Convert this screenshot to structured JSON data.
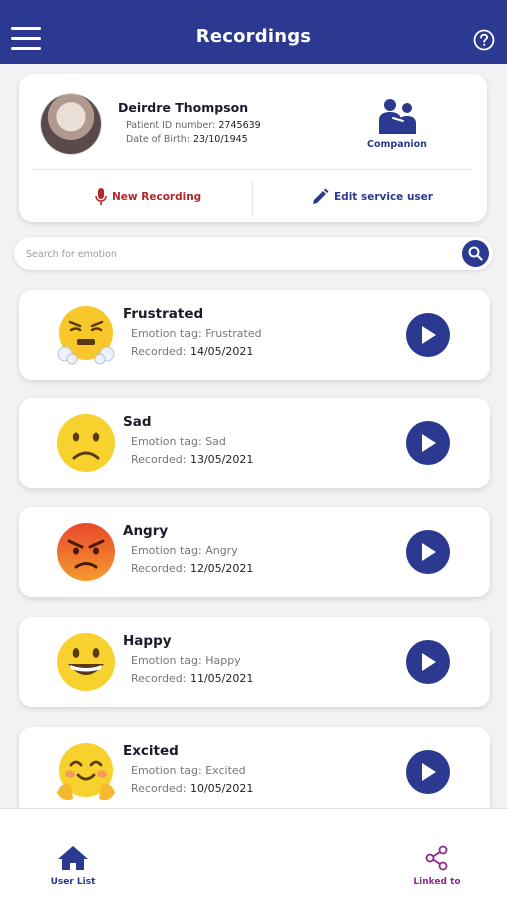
{
  "header": {
    "title": "Recordings"
  },
  "patient": {
    "name": "Deirdre Thompson",
    "id_label": "Patient ID number:",
    "id_value": "2745639",
    "dob_label": "Date of Birth:",
    "dob_value": "23/10/1945",
    "role_label": "Companion"
  },
  "actions": {
    "new_recording": "New Recording",
    "edit_user": "Edit service user"
  },
  "search": {
    "placeholder": "Search for emotion"
  },
  "recordings": [
    {
      "title": "Frustrated",
      "tag_label": "Emotion tag: ",
      "tag": "Frustrated",
      "date_label": "Recorded: ",
      "date": "14/05/2021",
      "emoji": "frustrated-emoji-icon"
    },
    {
      "title": "Sad",
      "tag_label": "Emotion tag: ",
      "tag": "Sad",
      "date_label": "Recorded: ",
      "date": "13/05/2021",
      "emoji": "sad-emoji-icon"
    },
    {
      "title": "Angry",
      "tag_label": "Emotion tag: ",
      "tag": "Angry",
      "date_label": "Recorded: ",
      "date": "12/05/2021",
      "emoji": "angry-emoji-icon"
    },
    {
      "title": "Happy",
      "tag_label": "Emotion tag: ",
      "tag": "Happy",
      "date_label": "Recorded: ",
      "date": "11/05/2021",
      "emoji": "happy-emoji-icon"
    },
    {
      "title": "Excited",
      "tag_label": "Emotion tag: ",
      "tag": "Excited",
      "date_label": "Recorded: ",
      "date": "10/05/2021",
      "emoji": "excited-emoji-icon"
    }
  ],
  "bottom_nav": {
    "user_list": "User List",
    "linked_to": "Linked to"
  },
  "colors": {
    "primary": "#2b3990",
    "record_red": "#b3262b",
    "linked_purple": "#8d2a8e"
  }
}
